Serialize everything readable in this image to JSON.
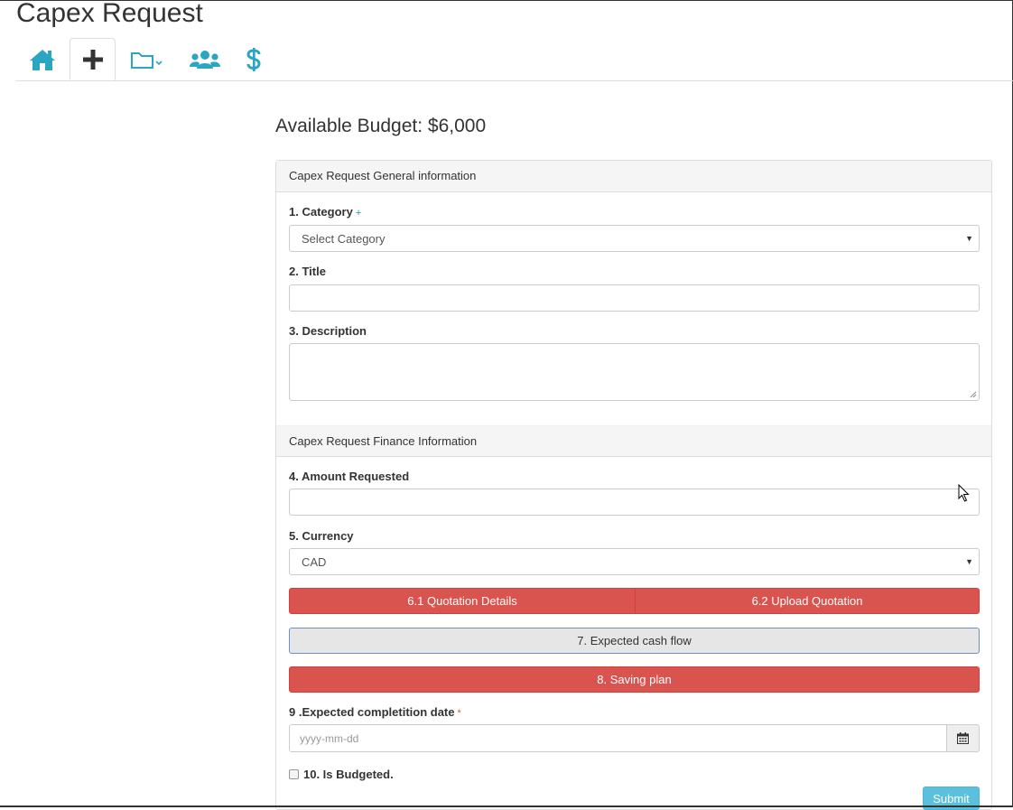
{
  "page": {
    "title": "Capex Request"
  },
  "nav": {
    "tabs": [
      {
        "icon": "home-icon",
        "active": false
      },
      {
        "icon": "plus-icon",
        "active": true
      },
      {
        "icon": "folder-dropdown-icon",
        "active": false
      },
      {
        "icon": "users-icon",
        "active": false
      },
      {
        "icon": "dollar-icon",
        "active": false
      }
    ]
  },
  "budget": {
    "text": "Available Budget: $6,000"
  },
  "general_section": {
    "heading": "Capex Request General information",
    "category": {
      "label": "1. Category",
      "required_mark": "+",
      "value": "Select Category"
    },
    "title_field": {
      "label": "2. Title",
      "value": ""
    },
    "description": {
      "label": "3. Description",
      "value": ""
    }
  },
  "finance_section": {
    "heading": "Capex Request Finance Information",
    "amount": {
      "label": "4. Amount Requested",
      "value": ""
    },
    "currency": {
      "label": "5. Currency",
      "value": "CAD"
    },
    "quotation_details_label": "6.1 Quotation Details",
    "upload_quotation_label": "6.2 Upload Quotation",
    "cash_flow_label": "7. Expected cash flow",
    "saving_plan_label": "8. Saving plan",
    "completion_date": {
      "label": "9 .Expected completition date",
      "required_mark": "*",
      "placeholder": "yyyy-mm-dd"
    },
    "budgeted": {
      "label": "10. Is Budgeted.",
      "checked": false
    },
    "submit_label": "Submit"
  },
  "colors": {
    "accent": "#2aa6c2",
    "danger": "#d9534f",
    "info": "#5bc0de"
  }
}
